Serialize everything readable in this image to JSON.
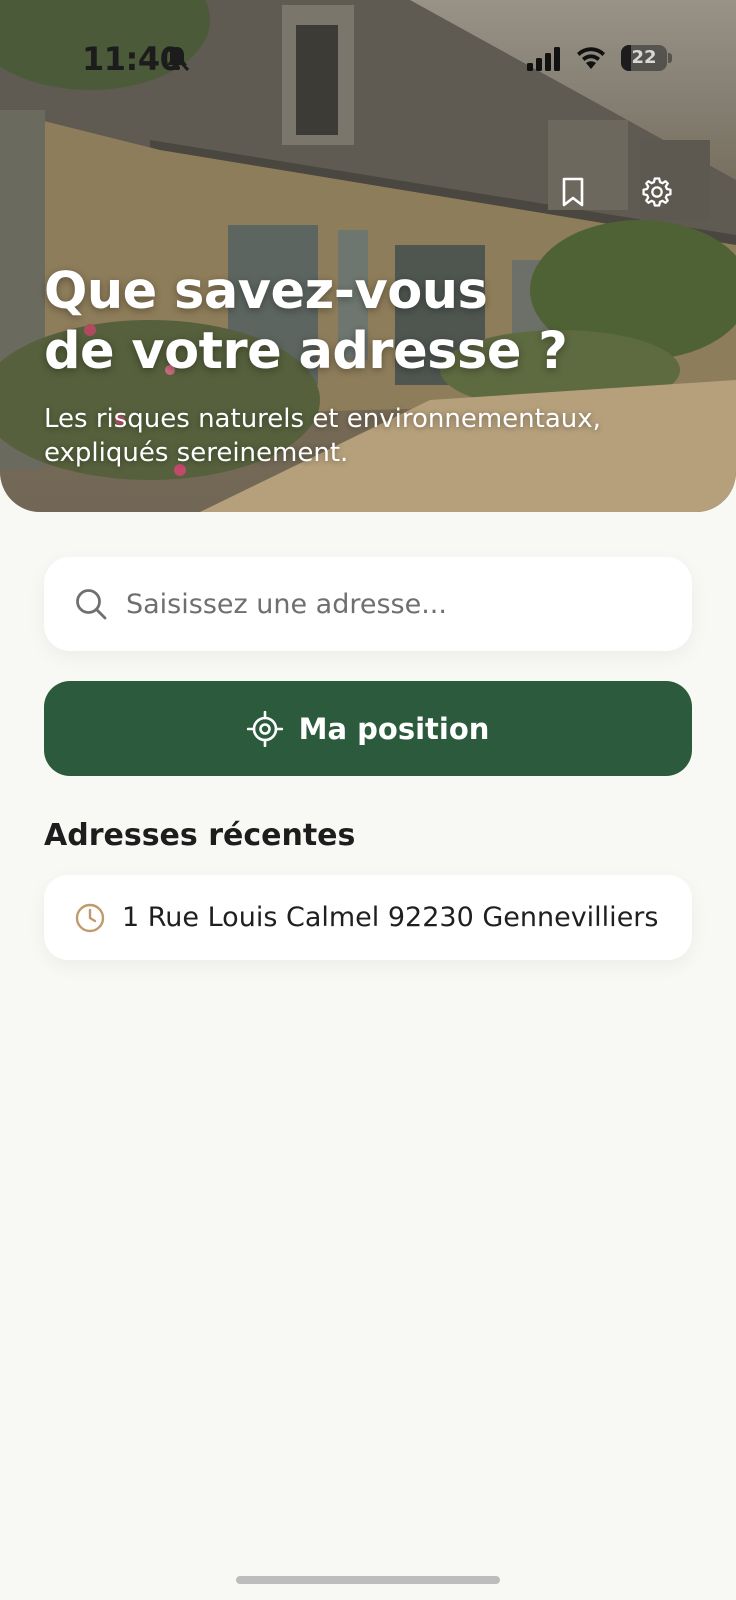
{
  "status_bar": {
    "time": "11:40",
    "battery": "22",
    "icons": [
      "bell-slash-icon",
      "signal-icon",
      "wifi-icon",
      "battery-icon"
    ]
  },
  "header": {
    "title_line1": "Que savez-vous",
    "title_line2": "de votre adresse ?",
    "subtitle_line1": "Les risques naturels et environnementaux,",
    "subtitle_line2": "expliqués sereinement.",
    "actions": [
      "bookmark-icon",
      "settings-gear-icon"
    ]
  },
  "search": {
    "placeholder": "Saisissez une adresse...",
    "value": "",
    "icon": "search-icon"
  },
  "position_button": {
    "label": "Ma position",
    "icon": "crosshair-locate-icon"
  },
  "recent": {
    "title": "Adresses récentes",
    "items": [
      {
        "text": "1 Rue Louis Calmel 92230 Gennevilliers",
        "icon": "clock-icon"
      }
    ]
  },
  "colors": {
    "primary": "#2b5b3c",
    "background": "#f8f8f4",
    "card": "#ffffff",
    "clock_accent": "#c09a6b",
    "hero_text": "#ffffff"
  }
}
